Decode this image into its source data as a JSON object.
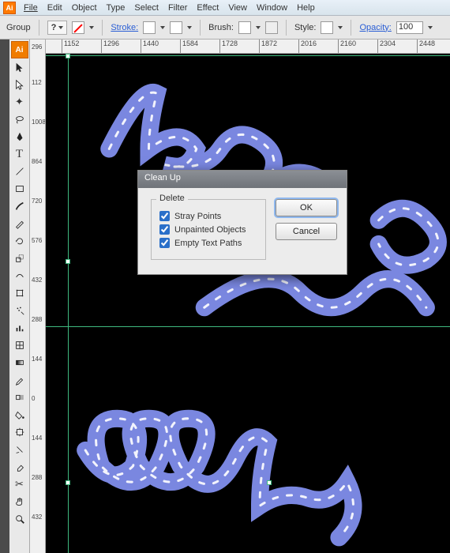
{
  "menu": {
    "items": [
      "File",
      "Edit",
      "Object",
      "Type",
      "Select",
      "Filter",
      "Effect",
      "View",
      "Window",
      "Help"
    ]
  },
  "controlbar": {
    "selection_label": "Group",
    "stroke_label": "Stroke:",
    "brush_label": "Brush:",
    "style_label": "Style:",
    "opacity_label": "Opacity:",
    "opacity_value": "100"
  },
  "hruler": {
    "ticks": [
      "1152",
      "1296",
      "1440",
      "1584",
      "1728",
      "1872",
      "2016",
      "2160",
      "2304",
      "2448"
    ]
  },
  "vruler": {
    "ticks": [
      "296",
      "112",
      "1008",
      "864",
      "720",
      "576",
      "432",
      "288",
      "144",
      "0",
      "144",
      "288",
      "432"
    ]
  },
  "dialog": {
    "title": "Clean Up",
    "group_label": "Delete",
    "options": [
      {
        "label": "Stray Points",
        "checked": true
      },
      {
        "label": "Unpainted Objects",
        "checked": true
      },
      {
        "label": "Empty Text Paths",
        "checked": true
      }
    ],
    "ok": "OK",
    "cancel": "Cancel"
  },
  "tools": {
    "ai": "Ai"
  }
}
